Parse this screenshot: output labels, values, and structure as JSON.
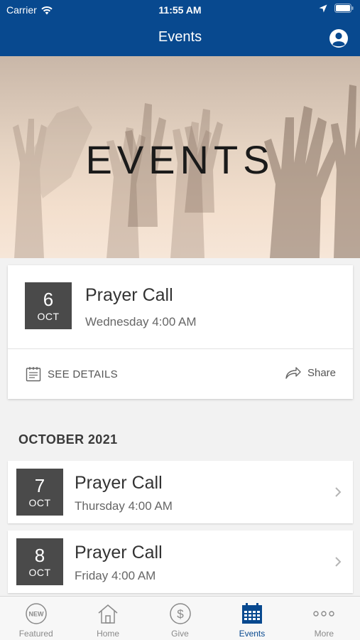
{
  "status_bar": {
    "carrier": "Carrier",
    "time": "11:55 AM"
  },
  "nav": {
    "title": "Events",
    "profile_icon": "user-circle-icon"
  },
  "hero": {
    "title": "EVENTS"
  },
  "featured_event": {
    "day": "6",
    "month": "OCT",
    "title": "Prayer Call",
    "time": "Wednesday 4:00 AM",
    "details_label": "SEE DETAILS",
    "share_label": "Share"
  },
  "section": {
    "header": "OCTOBER 2021"
  },
  "events": [
    {
      "day": "7",
      "month": "OCT",
      "title": "Prayer Call",
      "time": "Thursday 4:00 AM"
    },
    {
      "day": "8",
      "month": "OCT",
      "title": "Prayer Call",
      "time": "Friday 4:00 AM"
    }
  ],
  "tabbar": {
    "featured": "Featured",
    "featured_badge": "NEW",
    "home": "Home",
    "give": "Give",
    "events": "Events",
    "more": "More"
  },
  "colors": {
    "brand": "#08498f",
    "date_box": "#4a4a4a"
  }
}
